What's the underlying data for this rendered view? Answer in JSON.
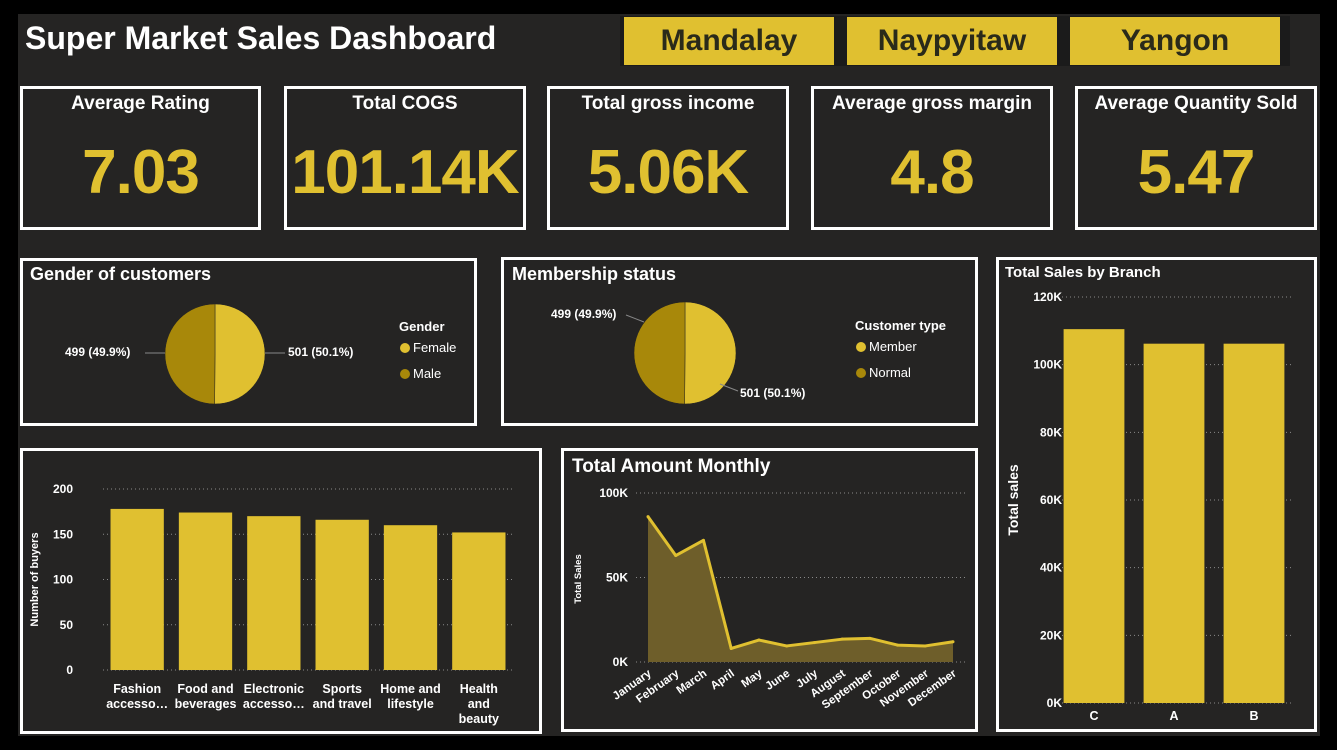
{
  "title": "Super Market Sales Dashboard",
  "slicer": [
    "Mandalay",
    "Naypyitaw",
    "Yangon"
  ],
  "cards": [
    {
      "label": "Average Rating",
      "value": "7.03"
    },
    {
      "label": "Total COGS",
      "value": "101.14K"
    },
    {
      "label": "Total gross income",
      "value": "5.06K"
    },
    {
      "label": "Average gross margin",
      "value": "4.8"
    },
    {
      "label": "Average Quantity Sold",
      "value": "5.47"
    }
  ],
  "colors": {
    "gold": "#E0C030",
    "dark_gold": "#A8880A",
    "panel": "#252423"
  },
  "gender": {
    "title": "Gender of customers",
    "legend_title": "Gender",
    "legend": [
      "Female",
      "Male"
    ],
    "label_left": "499 (49.9%)",
    "label_right": "501 (50.1%)"
  },
  "membership": {
    "title": "Membership status",
    "legend_title": "Customer type",
    "legend": [
      "Member",
      "Normal"
    ],
    "label_left": "499 (49.9%)",
    "label_right": "501 (50.1%)"
  },
  "chart_data": [
    {
      "type": "pie",
      "title": "Gender of customers",
      "legend_title": "Gender",
      "slices": [
        {
          "name": "Female",
          "value": 501,
          "percent": 50.1,
          "color": "#E0C030"
        },
        {
          "name": "Male",
          "value": 499,
          "percent": 49.9,
          "color": "#A8880A"
        }
      ]
    },
    {
      "type": "pie",
      "title": "Membership status",
      "legend_title": "Customer type",
      "slices": [
        {
          "name": "Member",
          "value": 501,
          "percent": 50.1,
          "color": "#E0C030"
        },
        {
          "name": "Normal",
          "value": 499,
          "percent": 49.9,
          "color": "#A8880A"
        }
      ]
    },
    {
      "type": "bar",
      "title": "",
      "categories": [
        "Fashion accesso…",
        "Food and beverages",
        "Electronic accesso…",
        "Sports and travel",
        "Home and lifestyle",
        "Health and beauty"
      ],
      "category_lines": [
        [
          "Fashion",
          "accesso…"
        ],
        [
          "Food and",
          "beverages"
        ],
        [
          "Electronic",
          "accesso…"
        ],
        [
          "Sports",
          "and travel"
        ],
        [
          "Home and",
          "lifestyle"
        ],
        [
          "Health",
          "and",
          "beauty"
        ]
      ],
      "values": [
        178,
        174,
        170,
        166,
        160,
        152
      ],
      "xlabel": "",
      "ylabel": "Number of buyers",
      "ylim": [
        0,
        200
      ],
      "yticks": [
        0,
        50,
        100,
        150,
        200
      ],
      "ytick_labels": [
        "0",
        "50",
        "100",
        "150",
        "200"
      ],
      "grid": true
    },
    {
      "type": "area",
      "title": "Total Amount Monthly",
      "x": [
        "January",
        "February",
        "March",
        "April",
        "May",
        "June",
        "July",
        "August",
        "September",
        "October",
        "November",
        "December"
      ],
      "values": [
        86000,
        63000,
        72000,
        8000,
        13000,
        9500,
        11500,
        13500,
        14000,
        10000,
        9500,
        12000
      ],
      "ylabel": "Total Sales",
      "xlabel": "",
      "ylim": [
        0,
        100000
      ],
      "yticks": [
        0,
        50000,
        100000
      ],
      "ytick_labels": [
        "0K",
        "50K",
        "100K"
      ],
      "grid": true
    },
    {
      "type": "bar",
      "title": "Total Sales by Branch",
      "categories": [
        "C",
        "A",
        "B"
      ],
      "values": [
        110500,
        106200,
        106200
      ],
      "xlabel": "",
      "ylabel": "Total sales",
      "ylim": [
        0,
        120000
      ],
      "yticks": [
        0,
        20000,
        40000,
        60000,
        80000,
        100000,
        120000
      ],
      "ytick_labels": [
        "0K",
        "20K",
        "40K",
        "60K",
        "80K",
        "100K",
        "120K"
      ],
      "grid": true
    }
  ]
}
